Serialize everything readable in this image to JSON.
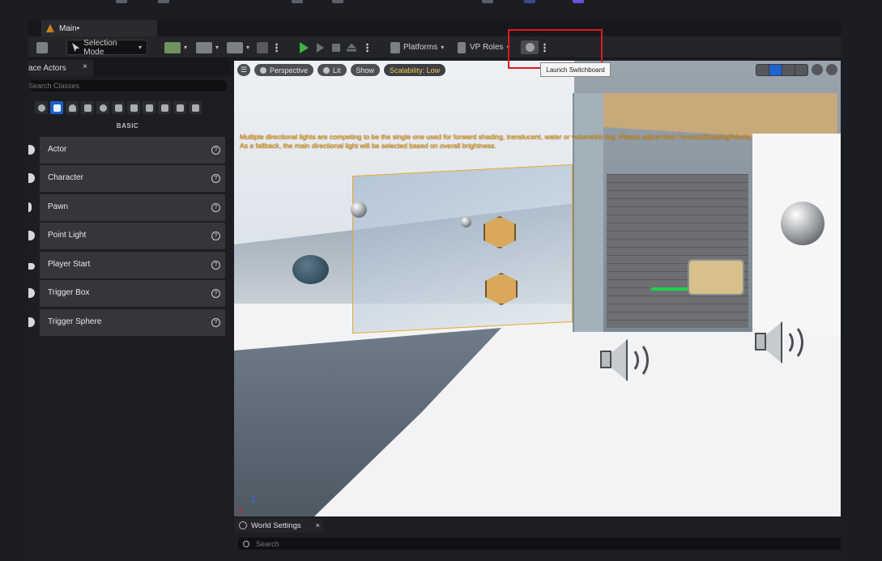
{
  "window": {
    "doc_tab": "Main•"
  },
  "toolbar": {
    "selection_mode": "Selection Mode",
    "platforms": "Platforms",
    "vp_roles": "VP Roles",
    "switchboard_tooltip": "Launch Switchboard"
  },
  "place_actors": {
    "tab_label": "ace Actors",
    "close": "×",
    "search_placeholder": "Search Classes",
    "category": "BASIC",
    "items": [
      {
        "label": "Actor"
      },
      {
        "label": "Character"
      },
      {
        "label": "Pawn"
      },
      {
        "label": "Point Light"
      },
      {
        "label": "Player Start"
      },
      {
        "label": "Trigger Box"
      },
      {
        "label": "Trigger Sphere"
      }
    ],
    "help_glyph": "?"
  },
  "viewport": {
    "perspective": "Perspective",
    "lit": "Lit",
    "show": "Show",
    "scalability": "Scalability: Low",
    "warning_line1": "Multiple directional lights are competing to be the single one used for forward shading, translucent, water or volumetric fog. Please adjust their ForwardShadingPriority.",
    "warning_line2": "As a fallback, the main directional light will be selected based on overall brightness.",
    "axis_z": "Z",
    "axis_x": "X"
  },
  "world_settings": {
    "tab_label": "World Settings",
    "close": "×",
    "search_placeholder": "Search"
  },
  "colors": {
    "accent_blue": "#1b5fc9",
    "play_green": "#3db43d",
    "warning_orange": "#f5a215",
    "highlight_red": "#e0191c",
    "scalability_yellow": "#f0c94a"
  }
}
